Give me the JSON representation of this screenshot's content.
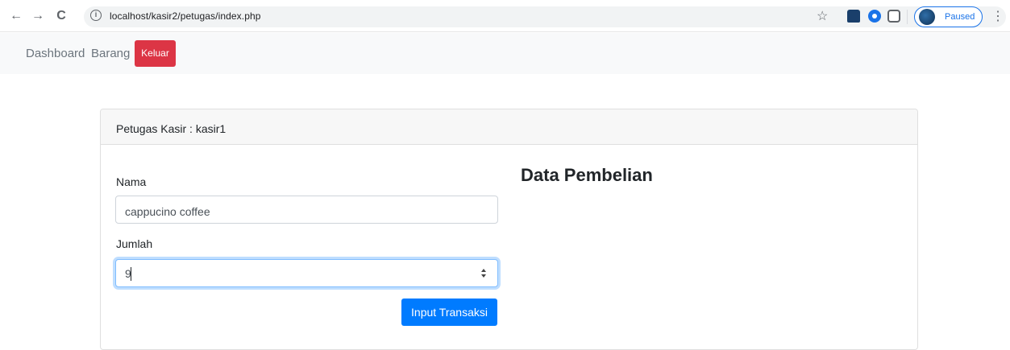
{
  "browser": {
    "url": "localhost/kasir2/petugas/index.php",
    "back_icon": "←",
    "forward_icon": "→",
    "reload_icon": "C",
    "info_icon": "i",
    "star_icon": "☆",
    "profile_label": "Paused",
    "menu_icon": "⋮"
  },
  "nav": {
    "items": [
      {
        "label": "Dashboard"
      },
      {
        "label": "Barang"
      }
    ],
    "logout_label": "Keluar",
    "logout_color": "#dc3545"
  },
  "card": {
    "header": "Petugas Kasir : kasir1"
  },
  "form": {
    "name_label": "Nama",
    "name_value": "cappucino coffee",
    "qty_label": "Jumlah",
    "qty_value": "9",
    "submit_label": "Input Transaksi",
    "submit_color": "#007bff"
  },
  "purchase": {
    "title": "Data Pembelian"
  }
}
